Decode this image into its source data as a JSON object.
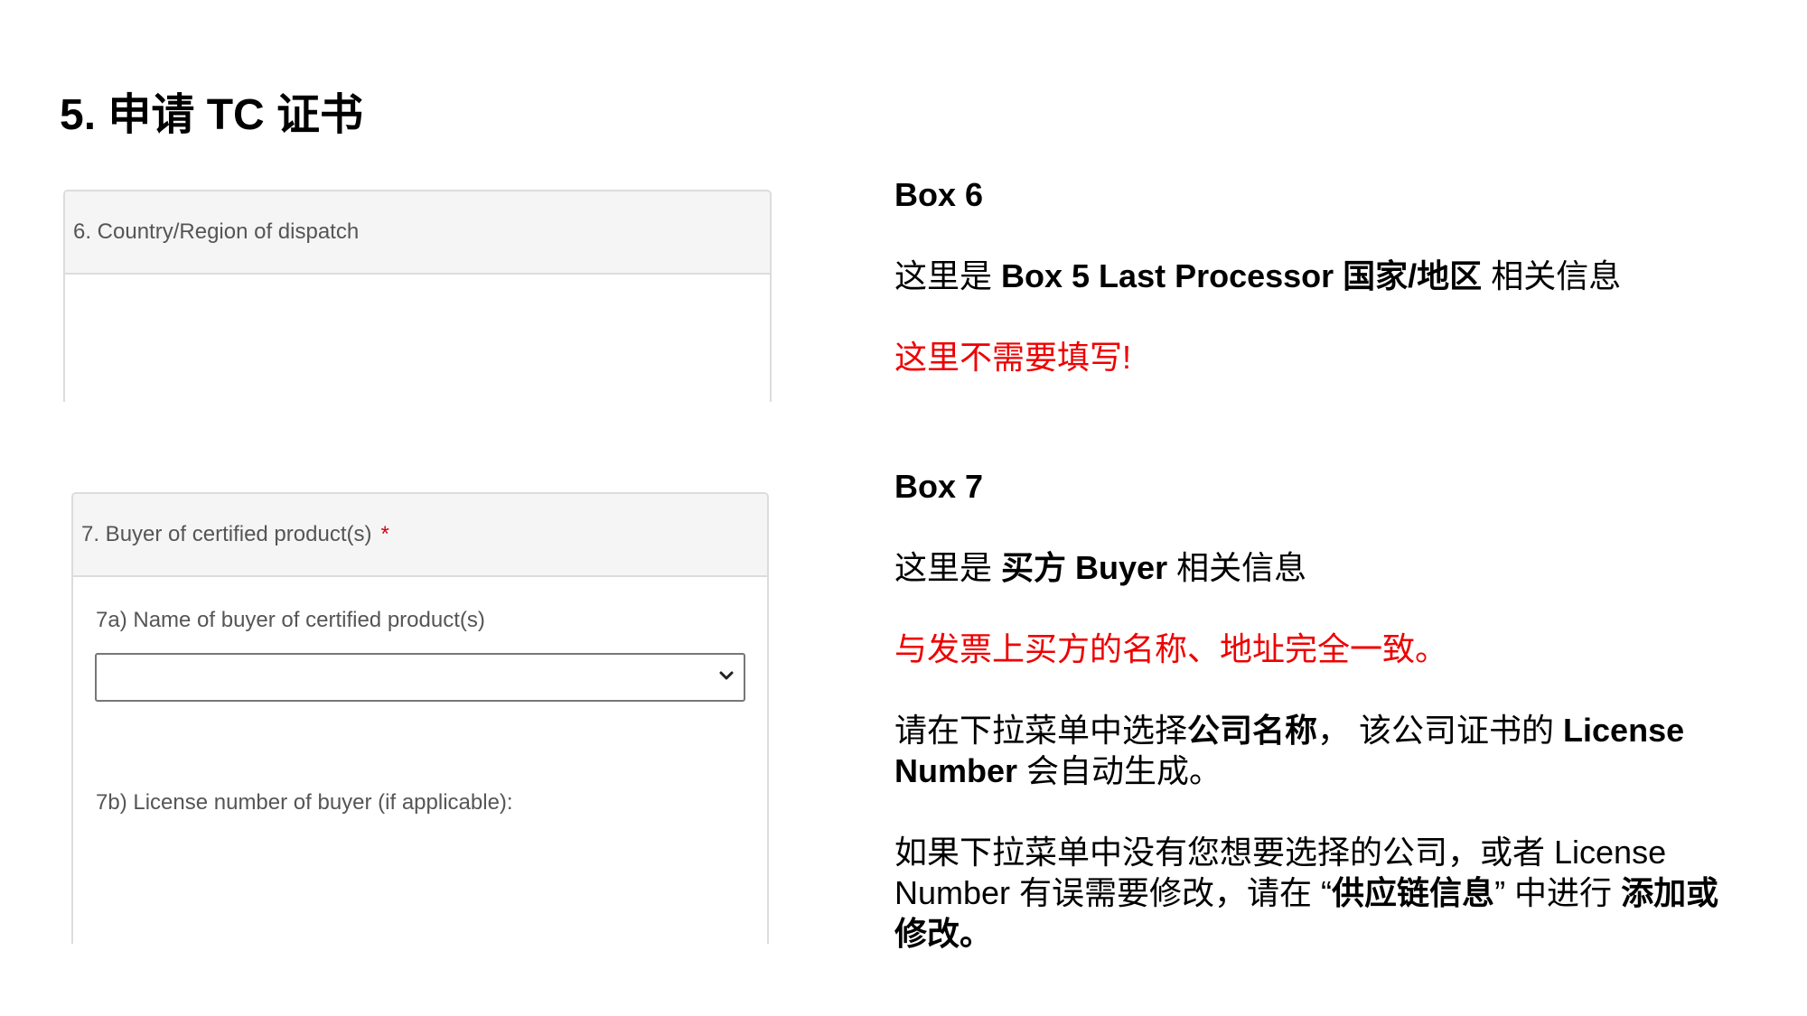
{
  "page": {
    "title": "5. 申请 TC 证书"
  },
  "box6_form": {
    "header_label": "6. Country/Region of dispatch"
  },
  "box7_form": {
    "header_label": "7. Buyer of certified product(s)",
    "required_mark": "*",
    "name_field_label": "7a) Name of buyer of certified product(s)",
    "name_select_value": "",
    "license_field_label": "7b) License number of buyer (if applicable):"
  },
  "box6_notes": {
    "heading": "Box 6",
    "line1_prefix": "这里是 ",
    "line1_bold": "Box 5 Last Processor 国家/地区",
    "line1_suffix": " 相关信息",
    "warning": "这里不需要填写!"
  },
  "box7_notes": {
    "heading": "Box 7",
    "line1_prefix": "这里是 ",
    "line1_bold1": "买方",
    "line1_bold2": " Buyer",
    "line1_suffix": " 相关信息",
    "warning": "与发票上买方的名称、地址完全一致。",
    "para2_part1": "请在下拉菜单中选择",
    "para2_bold1": "公司名称",
    "para2_part2": "，  该公司证书的 ",
    "para2_bold2": "License Number",
    "para2_part3": " 会自动生成。",
    "para3_part1": "如果下拉菜单中没有您想要选择的公司，或者 License Number 有误需要修改，请在 “",
    "para3_bold1": "供应链信息",
    "para3_part2": "” 中进行 ",
    "para3_bold2": "添加或修改。"
  },
  "colors": {
    "warning_text": "#ee0000",
    "required_star": "#d0021b",
    "panel_header_bg": "#f5f5f5",
    "panel_border": "#dcdcdc"
  }
}
